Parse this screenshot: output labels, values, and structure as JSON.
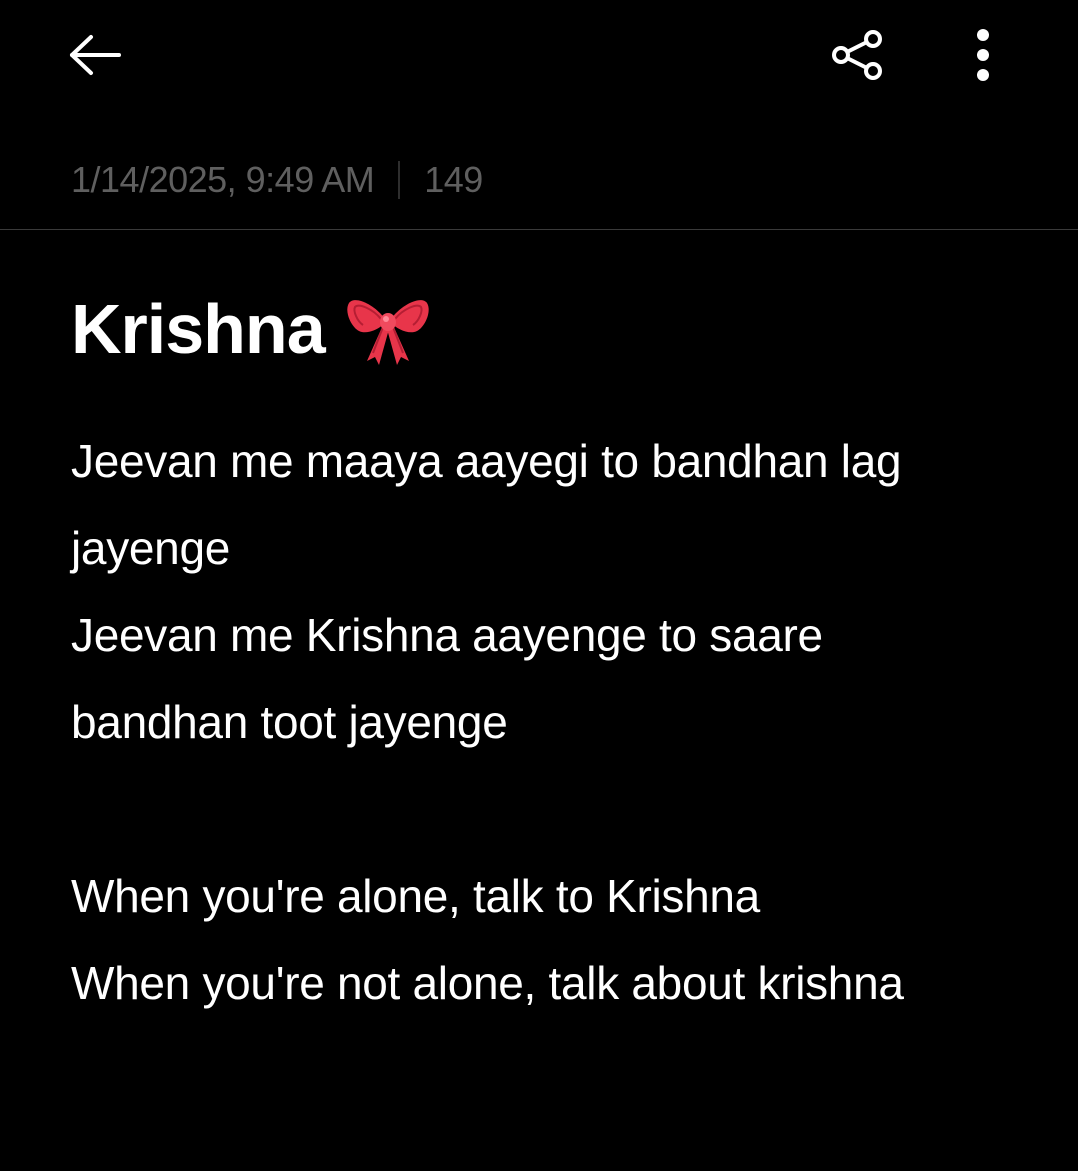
{
  "toolbar": {
    "back_icon": "arrow-left-icon",
    "share_icon": "share-icon",
    "more_icon": "more-vertical-icon"
  },
  "meta": {
    "timestamp": "1/14/2025, 9:49 AM",
    "char_count": "149"
  },
  "note": {
    "title": "Krishna",
    "title_emoji": "ribbon-bow",
    "lines": [
      "Jeevan me maaya aayegi to bandhan lag",
      "jayenge",
      "Jeevan me Krishna aayenge to saare",
      "bandhan toot jayenge",
      "",
      "When you're alone, talk to Krishna",
      "When you're not alone, talk about krishna"
    ]
  },
  "colors": {
    "background": "#000000",
    "text": "#ffffff",
    "meta_text": "#5f5f5f",
    "divider": "#3a3a3a",
    "bow": "#e8354a"
  }
}
